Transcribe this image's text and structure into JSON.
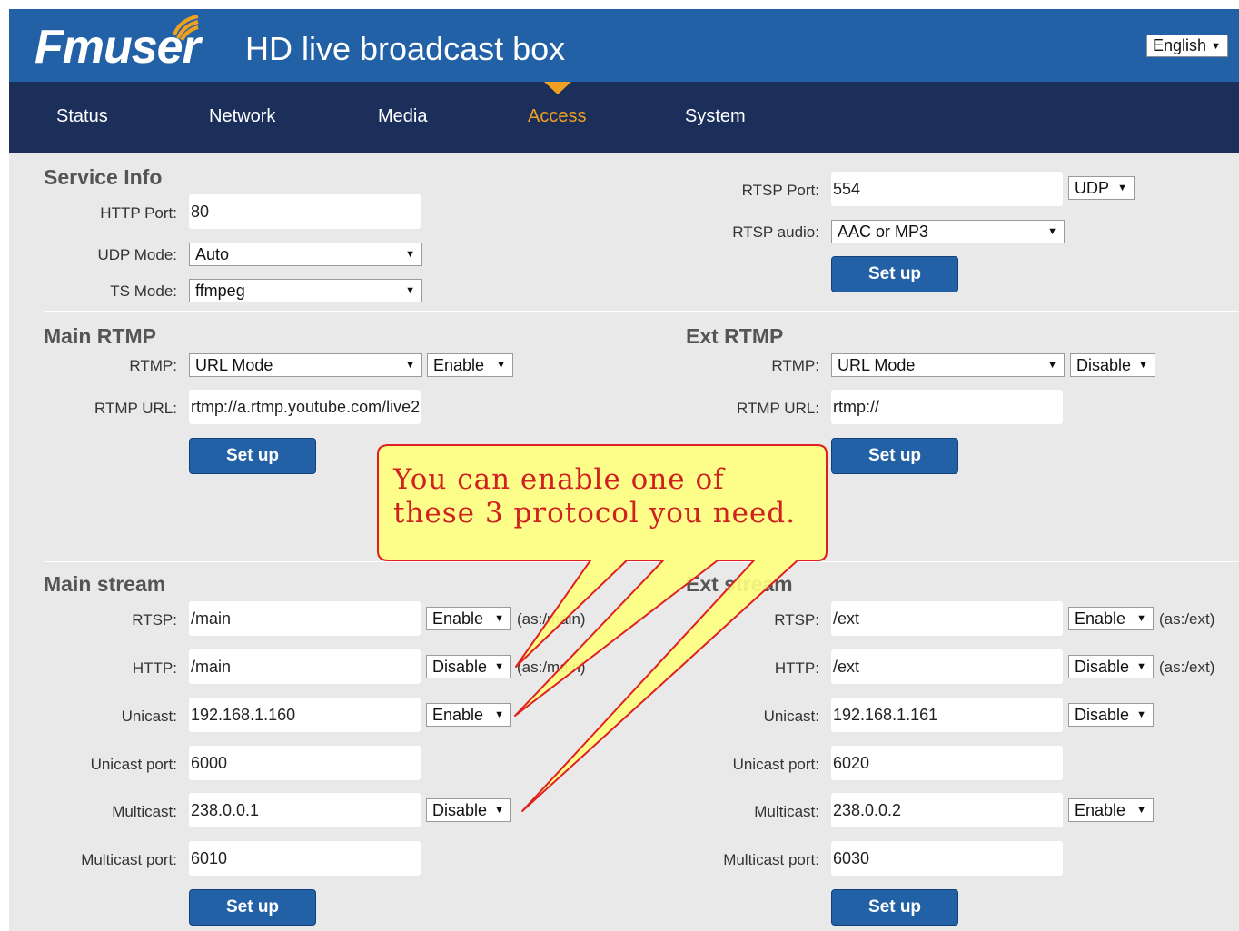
{
  "header": {
    "logo_text": "Fmuser",
    "title": "HD live broadcast box",
    "language": "English"
  },
  "nav": {
    "items": [
      "Status",
      "Network",
      "Media",
      "Access",
      "System"
    ],
    "active": "Access"
  },
  "service_info": {
    "title": "Service Info",
    "http_port_label": "HTTP Port:",
    "http_port": "80",
    "udp_mode_label": "UDP Mode:",
    "udp_mode": "Auto",
    "ts_mode_label": "TS Mode:",
    "ts_mode": "ffmpeg",
    "rtsp_port_label": "RTSP Port:",
    "rtsp_port": "554",
    "rtsp_transport": "UDP",
    "rtsp_audio_label": "RTSP audio:",
    "rtsp_audio": "AAC or MP3",
    "setup_label": "Set up"
  },
  "main_rtmp": {
    "title": "Main RTMP",
    "rtmp_label": "RTMP:",
    "rtmp_mode": "URL Mode",
    "rtmp_state": "Enable",
    "url_label": "RTMP URL:",
    "url": "rtmp://a.rtmp.youtube.com/live2",
    "setup_label": "Set up"
  },
  "ext_rtmp": {
    "title": "Ext RTMP",
    "rtmp_label": "RTMP:",
    "rtmp_mode": "URL Mode",
    "rtmp_state": "Disable",
    "url_label": "RTMP URL:",
    "url": "rtmp://",
    "setup_label": "Set up"
  },
  "main_stream": {
    "title": "Main stream",
    "rtsp_label": "RTSP:",
    "rtsp_path": "/main",
    "rtsp_state": "Enable",
    "rtsp_hint": "(as:/main)",
    "http_label": "HTTP:",
    "http_path": "/main",
    "http_state": "Disable",
    "http_hint": "(as:/main)",
    "unicast_label": "Unicast:",
    "unicast": "192.168.1.160",
    "unicast_state": "Enable",
    "unicast_port_label": "Unicast port:",
    "unicast_port": "6000",
    "multicast_label": "Multicast:",
    "multicast": "238.0.0.1",
    "multicast_state": "Disable",
    "multicast_port_label": "Multicast port:",
    "multicast_port": "6010",
    "setup_label": "Set up"
  },
  "ext_stream": {
    "title": "Ext stream",
    "rtsp_label": "RTSP:",
    "rtsp_path": "/ext",
    "rtsp_state": "Enable",
    "rtsp_hint": "(as:/ext)",
    "http_label": "HTTP:",
    "http_path": "/ext",
    "http_state": "Disable",
    "http_hint": "(as:/ext)",
    "unicast_label": "Unicast:",
    "unicast": "192.168.1.161",
    "unicast_state": "Disable",
    "unicast_port_label": "Unicast port:",
    "unicast_port": "6020",
    "multicast_label": "Multicast:",
    "multicast": "238.0.0.2",
    "multicast_state": "Enable",
    "multicast_port_label": "Multicast port:",
    "multicast_port": "6030",
    "setup_label": "Set up"
  },
  "callout": {
    "line1": "You can enable one of",
    "line2": "these 3 protocol you need."
  },
  "colors": {
    "header_bg": "#2361a6",
    "nav_bg": "#1b2f5a",
    "nav_active": "#f0a020",
    "button_bg": "#2361a6",
    "callout_fill": "#ffff80",
    "callout_border": "#e02020"
  }
}
